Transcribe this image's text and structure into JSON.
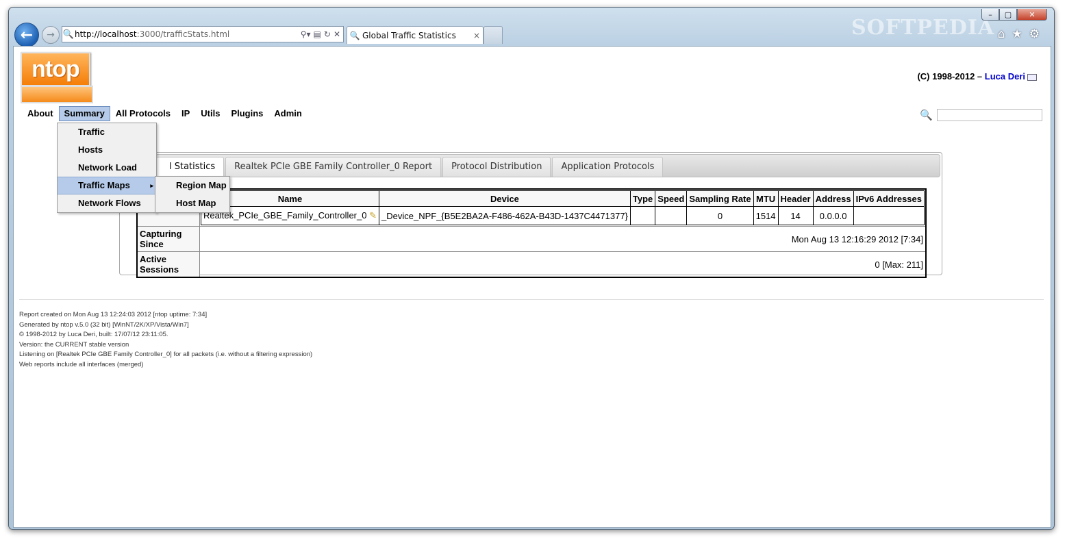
{
  "browser": {
    "url_host": "http://localhost",
    "url_rest": ":3000/trafficStats.html",
    "tab_title": "Global Traffic Statistics",
    "tab_close": "×",
    "back_glyph": "←",
    "forward_glyph": "→",
    "watermark": "SOFTPEDIA",
    "window_buttons": {
      "minimize": "–",
      "maximize": "▢",
      "close": "✕"
    },
    "tools": {
      "home": "⌂",
      "favorites": "★",
      "settings": "⚙"
    },
    "addr_tools": {
      "search": "⚲▾",
      "compat": "▤",
      "refresh": "↻",
      "stop": "✕"
    }
  },
  "header": {
    "logo_text": "ntop",
    "copyright_prefix": "(C) 1998-2012 – ",
    "author": "Luca Deri"
  },
  "menu": {
    "items": [
      "About",
      "Summary",
      "All Protocols",
      "IP",
      "Utils",
      "Plugins",
      "Admin"
    ],
    "active": "Summary",
    "summary_dropdown": [
      "Traffic",
      "Hosts",
      "Network Load",
      "Traffic Maps",
      "Network Flows"
    ],
    "submenu_arrow": "▸",
    "traffic_maps_submenu": [
      "Region Map",
      "Host Map"
    ]
  },
  "search": {
    "placeholder": ""
  },
  "panel": {
    "tabs": [
      "Global Statistics",
      "Realtek PCIe GBE Family Controller_0 Report",
      "Protocol Distribution",
      "Application Protocols"
    ],
    "selected_tab_visible_text": "l Statistics",
    "device_table": {
      "headers": [
        "Name",
        "Device",
        "Type",
        "Speed",
        "Sampling Rate",
        "MTU",
        "Header",
        "Address",
        "IPv6 Addresses"
      ],
      "row": [
        "Realtek_PCIe_GBE_Family_Controller_0",
        "_Device_NPF_{B5E2BA2A-F486-462A-B43D-1437C4471377}",
        "",
        "",
        "0",
        "1514",
        "14",
        "0.0.0.0",
        ""
      ]
    },
    "capturing_since_label": "Capturing Since",
    "capturing_since_value": "Mon Aug 13 12:16:29 2012 [7:34]",
    "active_sessions_label": "Active Sessions",
    "active_sessions_value": "0 [Max: 211]"
  },
  "footer": {
    "lines": [
      "Report created on Mon Aug 13 12:24:03 2012 [ntop uptime: 7:34]",
      "Generated by ntop v.5.0 (32 bit) [WinNT/2K/XP/Vista/Win7]",
      "© 1998-2012 by Luca Deri, built: 17/07/12 23:11:05.",
      "Version: the CURRENT stable version",
      "Listening on [Realtek PCIe GBE Family Controller_0] for all packets (i.e. without a filtering expression)",
      "Web reports include all interfaces (merged)"
    ]
  },
  "colors": {
    "accent": "#f57e08",
    "menu_highlight": "#b5cbe9",
    "link": "#0000cc"
  }
}
